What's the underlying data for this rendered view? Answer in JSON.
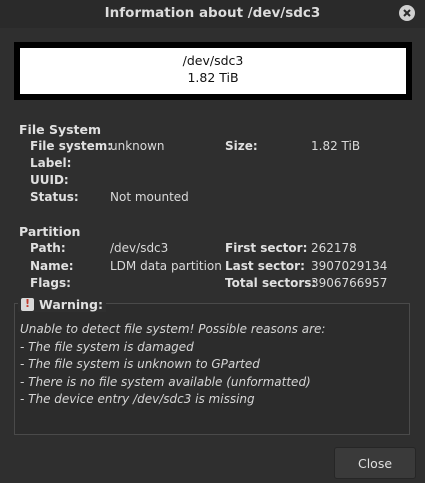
{
  "window": {
    "title": "Information about /dev/sdc3"
  },
  "device": {
    "path": "/dev/sdc3",
    "size": "1.82 TiB"
  },
  "filesystem": {
    "section_title": "File System",
    "labels": {
      "fs": "File system:",
      "label": "Label:",
      "uuid": "UUID:",
      "status": "Status:",
      "size": "Size:"
    },
    "values": {
      "fs": "unknown",
      "label": "",
      "uuid": "",
      "status": "Not mounted",
      "size": "1.82 TiB"
    }
  },
  "partition": {
    "section_title": "Partition",
    "labels": {
      "path": "Path:",
      "name": "Name:",
      "flags": "Flags:",
      "first": "First sector:",
      "last": "Last sector:",
      "total": "Total sectors:"
    },
    "values": {
      "path": "/dev/sdc3",
      "name": "LDM data partition",
      "flags": "",
      "first": "262178",
      "last": "3907029134",
      "total": "3906766957"
    }
  },
  "warning": {
    "label": "Warning:",
    "icon": "warning-icon",
    "lines": [
      "Unable to detect file system! Possible reasons are:",
      "- The file system is damaged",
      "- The file system is unknown to GParted",
      "- There is no file system available (unformatted)",
      "- The device entry /dev/sdc3 is missing"
    ]
  },
  "buttons": {
    "close": "Close"
  },
  "colors": {
    "background": "#2f2f2f",
    "text": "#e6e6e6",
    "titlebar": "#2a2a2a"
  }
}
